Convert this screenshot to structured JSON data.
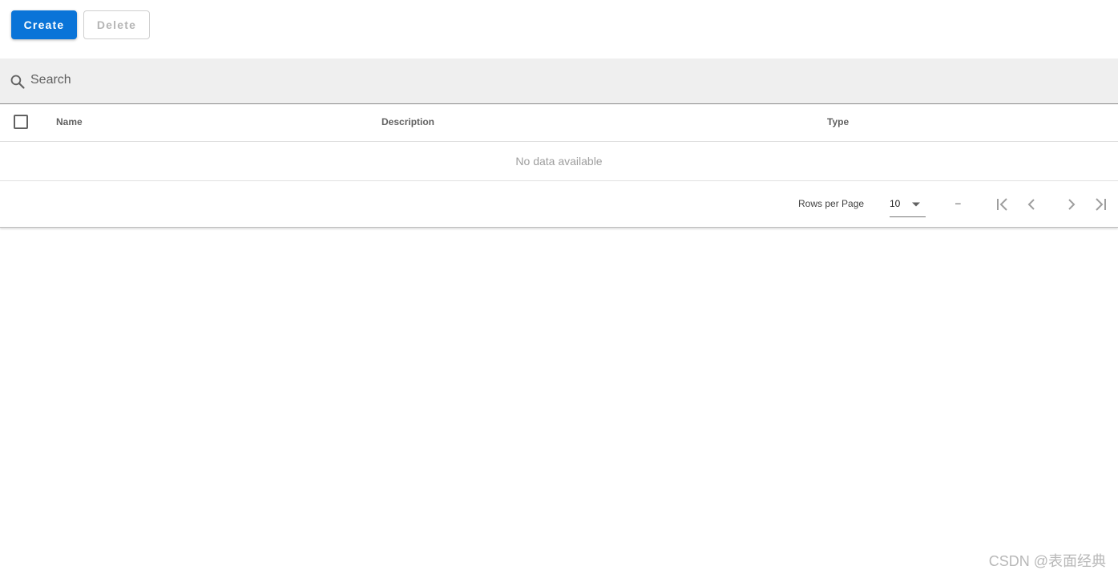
{
  "toolbar": {
    "create_label": "Create",
    "delete_label": "Delete",
    "create_color": "#0a74d8"
  },
  "search": {
    "placeholder": "Search",
    "value": ""
  },
  "table": {
    "columns": [
      "Name",
      "Description",
      "Type"
    ],
    "rows": [],
    "empty_text": "No data available"
  },
  "pagination": {
    "rows_per_page_label": "Rows per Page",
    "rows_per_page_value": "10",
    "range_text": "–"
  },
  "watermark": "CSDN @表面经典"
}
